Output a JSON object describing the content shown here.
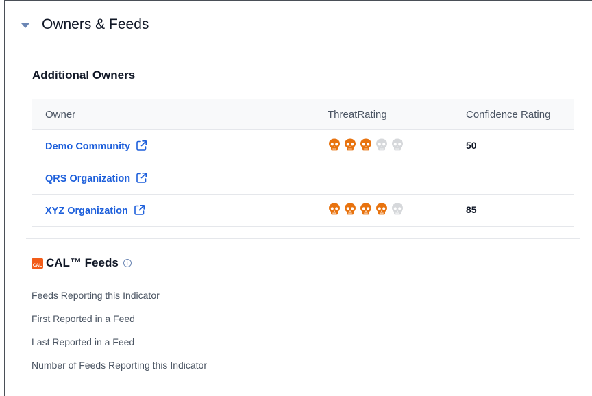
{
  "panel": {
    "title": "Owners & Feeds"
  },
  "owners": {
    "section_title": "Additional Owners",
    "columns": [
      "Owner",
      "ThreatRating",
      "Confidence Rating"
    ],
    "rows": [
      {
        "name": "Demo Community",
        "threat_rating": 3,
        "threat_max": 5,
        "confidence": "50"
      },
      {
        "name": "QRS Organization",
        "threat_rating": null,
        "threat_max": 5,
        "confidence": ""
      },
      {
        "name": "XYZ Organization",
        "threat_rating": 4,
        "threat_max": 5,
        "confidence": "85"
      }
    ]
  },
  "feeds": {
    "logo_text": "CAL",
    "title": "CAL™ Feeds",
    "info_icon": "info-circle-icon",
    "labels": [
      "Feeds Reporting this Indicator",
      "First Reported in a Feed",
      "Last Reported in a Feed",
      "Number of Feeds Reporting this Indicator"
    ]
  },
  "colors": {
    "skull_active": "#e8730f",
    "skull_inactive": "#d6d8db",
    "link": "#1d5fdb"
  }
}
